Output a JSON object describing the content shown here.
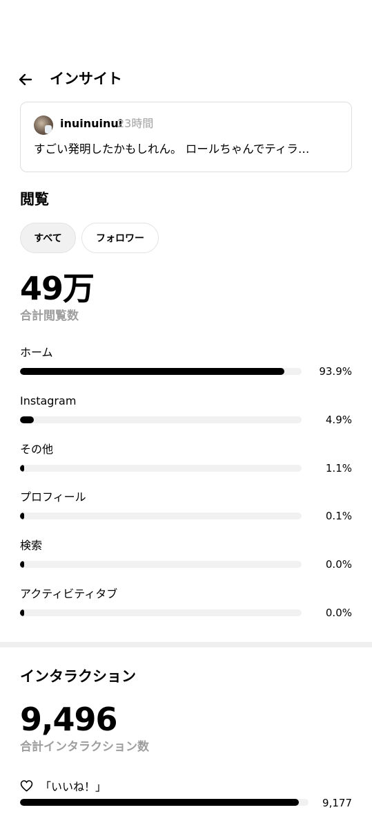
{
  "header": {
    "title": "インサイト",
    "back_icon": "arrow-left-icon"
  },
  "post": {
    "username": "inuinuinui",
    "time": "23時間",
    "text": "すごい発明したかもしれん。 ロールちゃんでティラ…"
  },
  "views": {
    "title": "閲覧",
    "filters": [
      {
        "label": "すべて",
        "selected": true
      },
      {
        "label": "フォロワー",
        "selected": false
      }
    ],
    "total": "49万",
    "total_label": "合計閲覧数",
    "sources": [
      {
        "label": "ホーム",
        "pct_text": "93.9%",
        "value": 93.9
      },
      {
        "label": "Instagram",
        "pct_text": "4.9%",
        "value": 4.9
      },
      {
        "label": "その他",
        "pct_text": "1.1%",
        "value": 1.1
      },
      {
        "label": "プロフィール",
        "pct_text": "0.1%",
        "value": 0.1
      },
      {
        "label": "検索",
        "pct_text": "0.0%",
        "value": 0.0
      },
      {
        "label": "アクティビティタブ",
        "pct_text": "0.0%",
        "value": 0.0
      }
    ]
  },
  "interactions": {
    "title": "インタラクション",
    "total": "9,496",
    "total_label": "合計インタラクション数",
    "likes": {
      "label": "「いいね！」",
      "count": "9,177",
      "value": 9177,
      "icon": "heart-icon"
    }
  }
}
